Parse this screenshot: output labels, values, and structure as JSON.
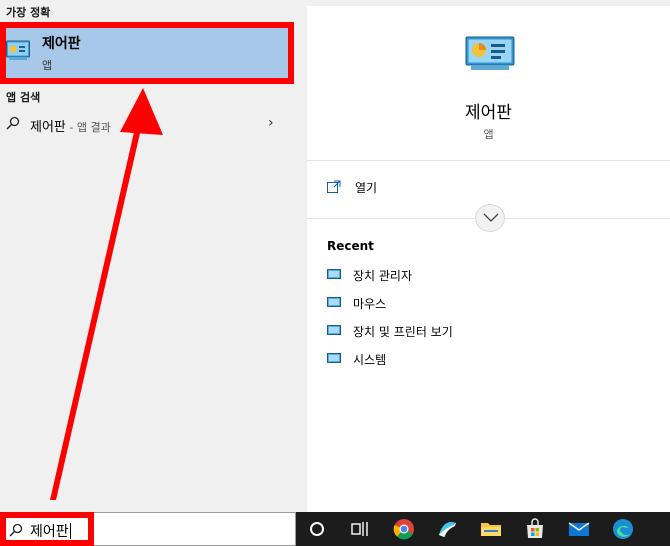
{
  "search_panel": {
    "best_match_header": "가장 정확",
    "best_match": {
      "title": "제어판",
      "type": "앱"
    },
    "web_search_header": "앱 검색",
    "web_result": {
      "text": "제어판",
      "hint": " - 앱 결과"
    }
  },
  "detail_panel": {
    "title": "제어판",
    "subtitle": "앱",
    "open_label": "열기",
    "recent_header": "Recent",
    "recent_items": [
      "장치 관리자",
      "마우스",
      "장치 및 프린터 보기",
      "시스템"
    ]
  },
  "taskbar": {
    "search_value": "제어판",
    "icons": [
      "cortana-circle-icon",
      "task-view-icon",
      "chrome-icon",
      "app-icon",
      "file-explorer-icon",
      "store-icon",
      "mail-icon",
      "edge-icon"
    ]
  },
  "colors": {
    "selection_bg": "#a7c8e8",
    "highlight_red": "#ff0000",
    "taskbar_bg": "#1c1c1c"
  }
}
